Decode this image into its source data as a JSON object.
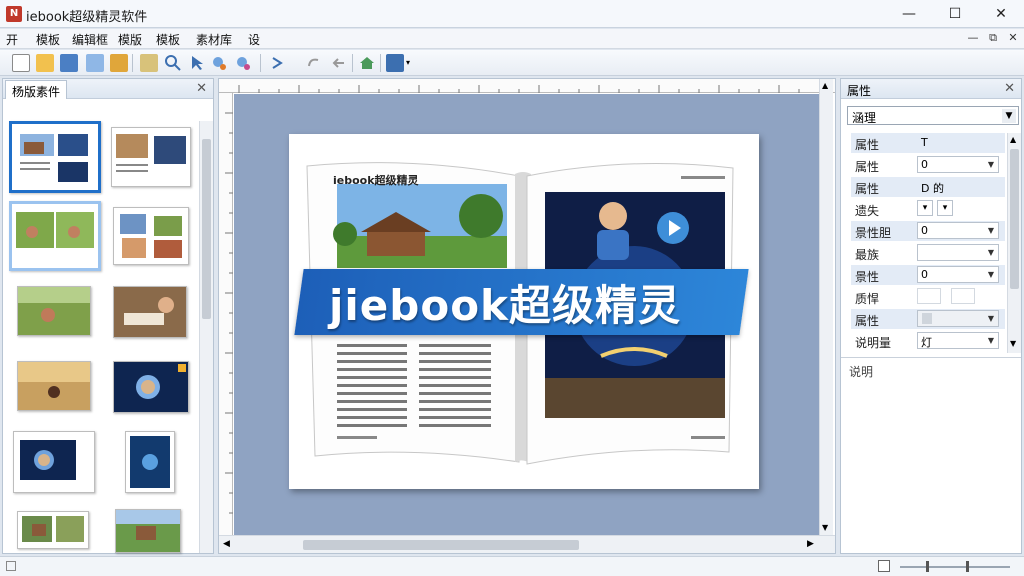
{
  "window": {
    "title": "iebook超级精灵软件",
    "app_icon_glyph": "N",
    "minimize": "—",
    "maximize": "☐",
    "close": "✕"
  },
  "menu": [
    "开",
    "模板",
    "编辑框",
    "模版",
    "模板",
    "素材库",
    "设"
  ],
  "mdi": {
    "minimize": "—",
    "restore": "⧉",
    "close": "✕"
  },
  "toolbar_icons": [
    "new-file-icon",
    "open-folder-icon",
    "save-icon",
    "edit-icon",
    "brush-icon",
    "page-icon",
    "search-icon",
    "pointer-icon",
    "zoom-in-icon",
    "zoom-out-icon",
    "undo-icon",
    "redo-icon",
    "back-icon",
    "home-icon",
    "publish-icon"
  ],
  "left_panel": {
    "tab": "杨版素件",
    "close": "✕"
  },
  "thumb_count": 10,
  "page": {
    "heading": "iebook超级精灵",
    "banner": "jiebook超级精灵"
  },
  "right_panel": {
    "title": "属性",
    "close": "✕",
    "selector": "涵理",
    "rows": [
      {
        "label": "属性",
        "value": "T",
        "kind": "text"
      },
      {
        "label": "属性",
        "value": "0",
        "kind": "select"
      },
      {
        "label": "属性",
        "value": "D 的",
        "kind": "text"
      },
      {
        "label": "遗失",
        "value": "▾",
        "kind": "mini"
      },
      {
        "label": "景性胆",
        "value": "0",
        "kind": "select"
      },
      {
        "label": "最族",
        "value": "",
        "kind": "select"
      },
      {
        "label": "景性",
        "value": "0",
        "kind": "select"
      },
      {
        "label": "质悍",
        "value": "",
        "kind": "boxes"
      },
      {
        "label": "属性",
        "value": "",
        "kind": "select"
      },
      {
        "label": "说明量",
        "value": "灯",
        "kind": "select"
      }
    ],
    "desc_label": "说明"
  },
  "colors": {
    "accent": "#1f6fc9",
    "canvas": "#8fa3c2",
    "banner": "#2d86d9"
  }
}
